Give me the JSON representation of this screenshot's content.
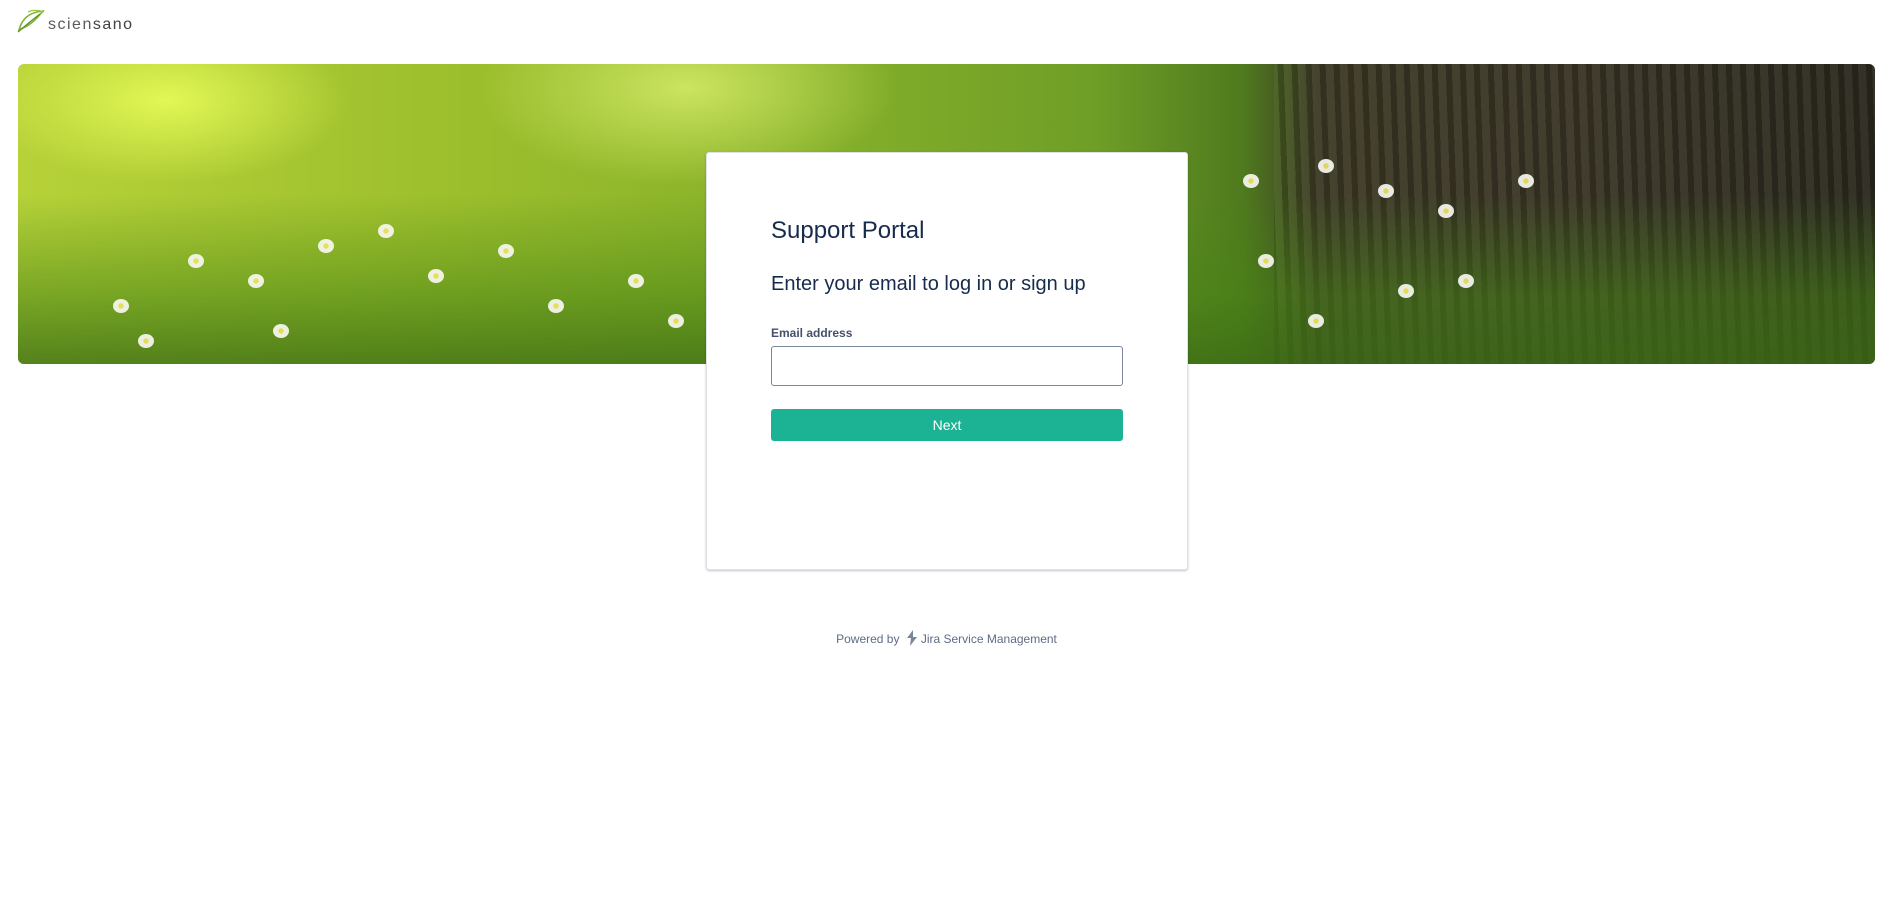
{
  "header": {
    "brand_part1": "scien",
    "brand_part2": "sano",
    "logo_icon": "sciensano-leaf-icon"
  },
  "banner": {
    "image": "meadow-flowers-tree-banner"
  },
  "login_card": {
    "title": "Support Portal",
    "subtitle": "Enter your email to log in or sign up",
    "email_label": "Email address",
    "email_value": "",
    "email_placeholder": "",
    "next_button": "Next"
  },
  "footer": {
    "powered_by": "Powered by",
    "product_icon": "jira-service-management-icon",
    "product_name": "Jira Service Management"
  },
  "colors": {
    "accent": "#1bb394",
    "text_primary": "#172b4d",
    "text_secondary": "#5e6c84"
  }
}
